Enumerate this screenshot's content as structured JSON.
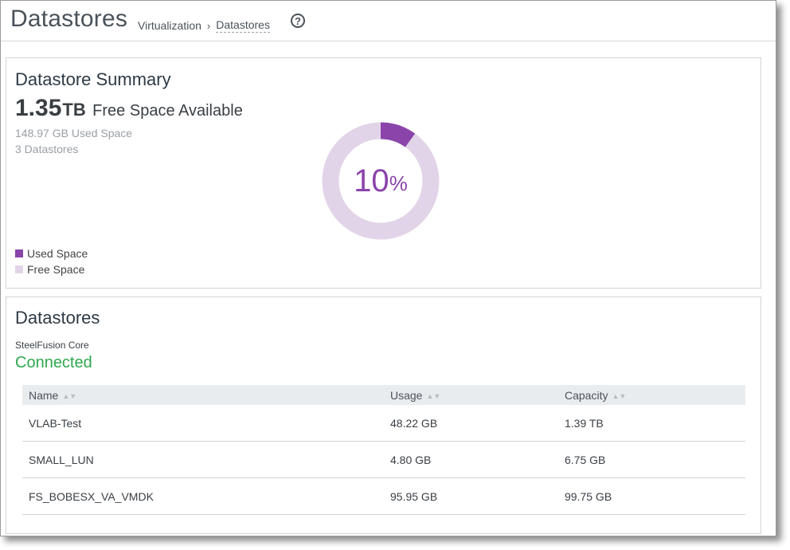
{
  "header": {
    "title": "Datastores",
    "breadcrumb": {
      "parent": "Virtualization",
      "separator": "›",
      "current": "Datastores"
    },
    "help_icon": "?"
  },
  "summary": {
    "title": "Datastore Summary",
    "free_value": "1.35",
    "free_unit": "TB",
    "free_label": "Free Space Available",
    "used_space": "148.97 GB Used Space",
    "datastore_count": "3 Datastores",
    "donut": {
      "percent_text": "10",
      "percent_sign": "%",
      "used_fraction": 0.1
    },
    "legend": [
      {
        "label": "Used Space",
        "color": "#8a44aa"
      },
      {
        "label": "Free Space",
        "color": "#e2d4e8"
      }
    ]
  },
  "datastores": {
    "title": "Datastores",
    "core_label": "SteelFusion Core",
    "core_status": "Connected",
    "columns": [
      "Name",
      "Usage",
      "Capacity"
    ],
    "rows": [
      {
        "name": "VLAB-Test",
        "usage": "48.22 GB",
        "capacity": "1.39 TB"
      },
      {
        "name": "SMALL_LUN",
        "usage": "4.80 GB",
        "capacity": "6.75 GB"
      },
      {
        "name": "FS_BOBESX_VA_VMDK",
        "usage": "95.95 GB",
        "capacity": "99.75 GB"
      }
    ]
  },
  "colors": {
    "used": "#8a44aa",
    "free": "#e2d4e8",
    "connected": "#2ea84f",
    "table_header_bg": "#e9ecef"
  }
}
